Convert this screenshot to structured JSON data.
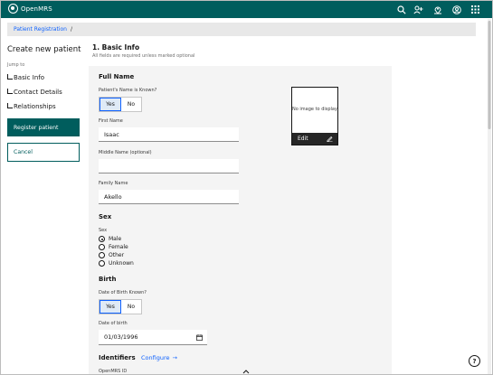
{
  "app": {
    "name": "OpenMRS"
  },
  "header": {
    "icons": [
      "search-icon",
      "add-user-icon",
      "location-icon",
      "user-avatar-icon",
      "app-switcher-icon"
    ]
  },
  "breadcrumb": {
    "items": [
      "Patient Registration"
    ],
    "separator": "/"
  },
  "sidebar": {
    "title": "Create new patient",
    "jump_to": "Jump to",
    "items": [
      {
        "label": "Basic Info"
      },
      {
        "label": "Contact Details"
      },
      {
        "label": "Relationships"
      }
    ],
    "register_label": "Register patient",
    "cancel_label": "Cancel"
  },
  "form": {
    "section_title": "1. Basic Info",
    "section_subtitle": "All fields are required unless marked optional",
    "full_name_heading": "Full Name",
    "name_known_label": "Patient's Name is Known?",
    "name_known_options": [
      "Yes",
      "No"
    ],
    "name_known_selected": "Yes",
    "first_name_label": "First Name",
    "first_name_value": "Isaac",
    "middle_name_label": "Middle Name (optional)",
    "middle_name_value": "",
    "family_name_label": "Family Name",
    "family_name_value": "Akello",
    "sex_heading": "Sex",
    "sex_label": "Sex",
    "sex_options": [
      "Male",
      "Female",
      "Other",
      "Unknown"
    ],
    "sex_selected": "Male",
    "birth_heading": "Birth",
    "dob_known_label": "Date of Birth Known?",
    "dob_known_options": [
      "Yes",
      "No"
    ],
    "dob_known_selected": "Yes",
    "dob_label": "Date of birth",
    "dob_value": "01/03/1996",
    "identifiers_heading": "Identifiers",
    "configure_label": "Configure",
    "configure_arrow": "→",
    "openmrs_id_label": "OpenMRS ID"
  },
  "photo": {
    "no_image_text": "No image to display",
    "edit_label": "Edit"
  },
  "help": {
    "label": "?"
  },
  "colors": {
    "brand": "#005d5d",
    "link": "#0f62fe",
    "panel": "#f4f4f4"
  }
}
